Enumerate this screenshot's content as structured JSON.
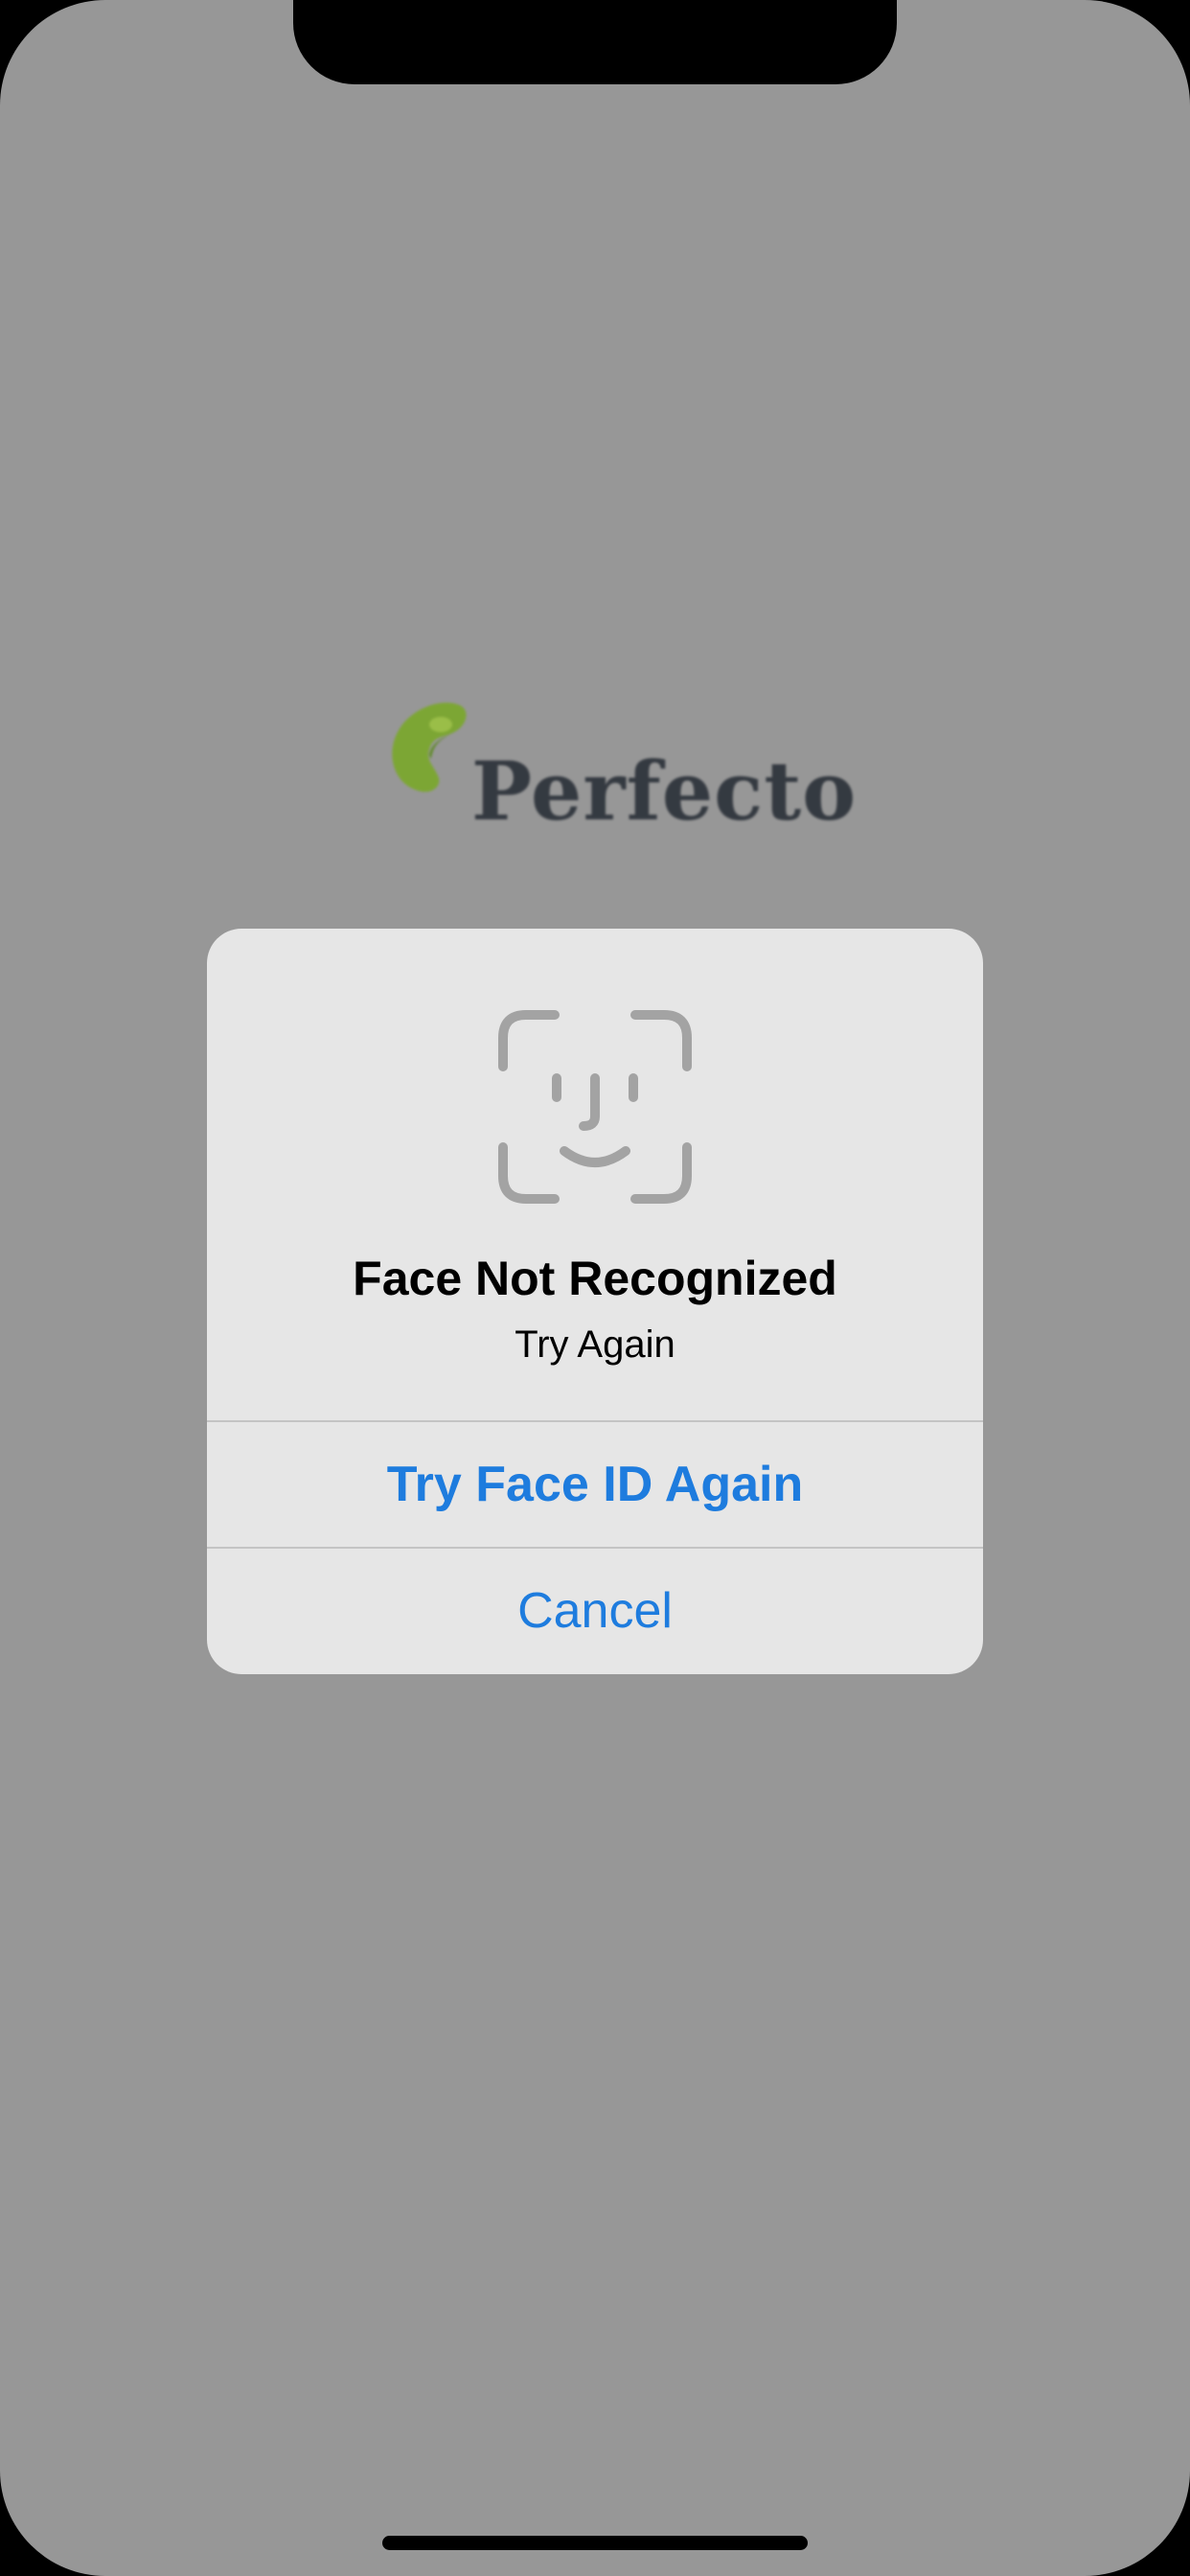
{
  "app": {
    "logo_text": "Perfecto",
    "logo_icon": "perfecto-leaf-logo"
  },
  "alert": {
    "icon": "face-id-icon",
    "title": "Face Not Recognized",
    "message": "Try Again",
    "primary_button": "Try Face ID Again",
    "cancel_button": "Cancel"
  },
  "colors": {
    "overlay_background": "#979797",
    "alert_background": "#e6e6e6",
    "button_blue": "#1e7cde",
    "faceid_gray": "#a3a3a3",
    "logo_green": "#7aa82a",
    "logo_text": "#2a3038"
  }
}
